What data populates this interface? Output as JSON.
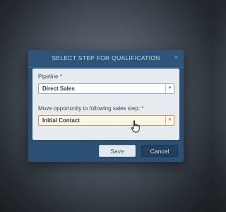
{
  "dialog": {
    "title": "SELECT STEP FOR QUALIFICATION",
    "close_glyph": "×",
    "pipeline": {
      "label": "Pipeline *",
      "value": "Direct Sales"
    },
    "step": {
      "label": "Move opportunity to following sales step: *",
      "value": "Initial Contact"
    },
    "buttons": {
      "save": "Save",
      "cancel": "Cancel"
    }
  },
  "icons": {
    "close": "close-icon",
    "dropdown": "chevron-down-icon",
    "cursor": "hand-pointer-icon"
  },
  "colors": {
    "titlebar": "#2f5479",
    "active_field": "#fbf5e8",
    "cancel_button": "#233f5f"
  }
}
